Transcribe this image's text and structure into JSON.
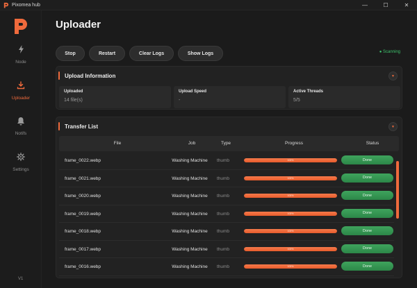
{
  "window": {
    "title": "Pixomea hub",
    "controls": [
      "—",
      "☐",
      "✕"
    ]
  },
  "sidebar": {
    "items": [
      {
        "label": "Node",
        "icon": "bolt-icon"
      },
      {
        "label": "Uploader",
        "icon": "upload-icon",
        "active": true
      },
      {
        "label": "Notifs",
        "icon": "bell-icon"
      },
      {
        "label": "Settings",
        "icon": "gear-icon"
      }
    ],
    "version": "V1"
  },
  "page": {
    "title": "Uploader"
  },
  "toolbar": {
    "stop_label": "Stop",
    "restart_label": "Restart",
    "clear_logs_label": "Clear Logs",
    "show_logs_label": "Show Logs",
    "status": "● Scanning"
  },
  "upload_info": {
    "title": "Upload Information",
    "toggle": "▼",
    "cards": [
      {
        "label": "Uploaded",
        "value": "14 file(s)"
      },
      {
        "label": "Upload Speed",
        "value": "-"
      },
      {
        "label": "Active Threads",
        "value": "5/5"
      }
    ]
  },
  "transfer": {
    "title": "Transfer List",
    "toggle": "▼",
    "columns": [
      "File",
      "Job",
      "Type",
      "Progress",
      "Status"
    ],
    "rows": [
      {
        "file": "frame_0022.webp",
        "job": "Washing Machine",
        "type": "thumb",
        "progress": 100,
        "progress_text": "100%",
        "status": "Done"
      },
      {
        "file": "frame_0021.webp",
        "job": "Washing Machine",
        "type": "thumb",
        "progress": 100,
        "progress_text": "100%",
        "status": "Done"
      },
      {
        "file": "frame_0020.webp",
        "job": "Washing Machine",
        "type": "thumb",
        "progress": 100,
        "progress_text": "100%",
        "status": "Done"
      },
      {
        "file": "frame_0019.webp",
        "job": "Washing Machine",
        "type": "thumb",
        "progress": 100,
        "progress_text": "100%",
        "status": "Done"
      },
      {
        "file": "frame_0018.webp",
        "job": "Washing Machine",
        "type": "thumb",
        "progress": 100,
        "progress_text": "100%",
        "status": "Done"
      },
      {
        "file": "frame_0017.webp",
        "job": "Washing Machine",
        "type": "thumb",
        "progress": 100,
        "progress_text": "100%",
        "status": "Done"
      },
      {
        "file": "frame_0016.webp",
        "job": "Washing Machine",
        "type": "thumb",
        "progress": 100,
        "progress_text": "100%",
        "status": "Done"
      }
    ]
  },
  "colors": {
    "accent": "#ef6a3c",
    "success": "#3fa45d",
    "background": "#1b1b1b",
    "panel": "#222222"
  }
}
